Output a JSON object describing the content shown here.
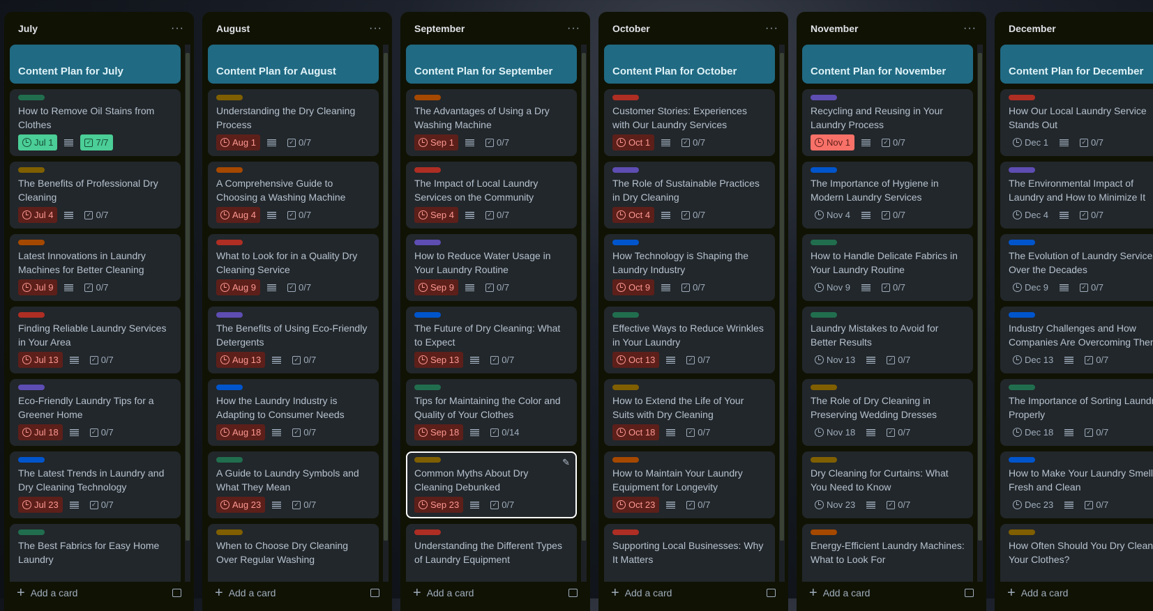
{
  "colors": {
    "green": "#216e4e",
    "yellow": "#7f5f01",
    "orange": "#a54800",
    "red": "#ae2e24",
    "purple": "#5e4db2",
    "blue": "#0055cc",
    "header_card": "#206a83"
  },
  "add_card_label": "Add a card",
  "lists": [
    {
      "title": "July",
      "header_card": "Content Plan for July",
      "cards": [
        {
          "label": "green",
          "title": "How to Remove Oil Stains from Clothes",
          "due": "Jul 1",
          "due_state": "complete",
          "checklist": "7/7",
          "checklist_state": "complete"
        },
        {
          "label": "yellow",
          "title": "The Benefits of Professional Dry Cleaning",
          "due": "Jul 4",
          "due_state": "overdue",
          "checklist": "0/7"
        },
        {
          "label": "orange",
          "title": "Latest Innovations in Laundry Machines for Better Cleaning",
          "due": "Jul 9",
          "due_state": "overdue",
          "checklist": "0/7"
        },
        {
          "label": "red",
          "title": "Finding Reliable Laundry Services in Your Area",
          "due": "Jul 13",
          "due_state": "overdue",
          "checklist": "0/7"
        },
        {
          "label": "purple",
          "title": "Eco-Friendly Laundry Tips for a Greener Home",
          "due": "Jul 18",
          "due_state": "overdue",
          "checklist": "0/7"
        },
        {
          "label": "blue",
          "title": "The Latest Trends in Laundry and Dry Cleaning Technology",
          "due": "Jul 23",
          "due_state": "overdue",
          "checklist": "0/7"
        },
        {
          "label": "green",
          "title": "The Best Fabrics for Easy Home Laundry"
        }
      ]
    },
    {
      "title": "August",
      "header_card": "Content Plan for August",
      "cards": [
        {
          "label": "yellow",
          "title": "Understanding the Dry Cleaning Process",
          "due": "Aug 1",
          "due_state": "overdue",
          "checklist": "0/7"
        },
        {
          "label": "orange",
          "title": "A Comprehensive Guide to Choosing a Washing Machine",
          "due": "Aug 4",
          "due_state": "overdue",
          "checklist": "0/7"
        },
        {
          "label": "red",
          "title": "What to Look for in a Quality Dry Cleaning Service",
          "due": "Aug 9",
          "due_state": "overdue",
          "checklist": "0/7"
        },
        {
          "label": "purple",
          "title": "The Benefits of Using Eco-Friendly Detergents",
          "due": "Aug 13",
          "due_state": "overdue",
          "checklist": "0/7"
        },
        {
          "label": "blue",
          "title": "How the Laundry Industry is Adapting to Consumer Needs",
          "due": "Aug 18",
          "due_state": "overdue",
          "checklist": "0/7"
        },
        {
          "label": "green",
          "title": "A Guide to Laundry Symbols and What They Mean",
          "due": "Aug 23",
          "due_state": "overdue",
          "checklist": "0/7"
        },
        {
          "label": "yellow",
          "title": "When to Choose Dry Cleaning Over Regular Washing"
        }
      ]
    },
    {
      "title": "September",
      "header_card": "Content Plan for September",
      "cards": [
        {
          "label": "orange",
          "title": "The Advantages of Using a Dry Washing Machine",
          "due": "Sep 1",
          "due_state": "overdue",
          "checklist": "0/7"
        },
        {
          "label": "red",
          "title": "The Impact of Local Laundry Services on the Community",
          "due": "Sep 4",
          "due_state": "overdue",
          "checklist": "0/7"
        },
        {
          "label": "purple",
          "title": "How to Reduce Water Usage in Your Laundry Routine",
          "due": "Sep 9",
          "due_state": "overdue",
          "checklist": "0/7"
        },
        {
          "label": "blue",
          "title": "The Future of Dry Cleaning: What to Expect",
          "due": "Sep 13",
          "due_state": "overdue",
          "checklist": "0/7"
        },
        {
          "label": "green",
          "title": "Tips for Maintaining the Color and Quality of Your Clothes",
          "due": "Sep 18",
          "due_state": "overdue",
          "checklist": "0/14"
        },
        {
          "label": "yellow",
          "title": "Common Myths About Dry Cleaning Debunked",
          "due": "Sep 23",
          "due_state": "overdue",
          "checklist": "0/7",
          "selected": true
        },
        {
          "label": "red",
          "title": "Understanding the Different Types of Laundry Equipment"
        }
      ]
    },
    {
      "title": "October",
      "header_card": "Content Plan for October",
      "cards": [
        {
          "label": "red",
          "title": "Customer Stories: Experiences with Our Laundry Services",
          "due": "Oct 1",
          "due_state": "overdue",
          "checklist": "0/7"
        },
        {
          "label": "purple",
          "title": "The Role of Sustainable Practices in Dry Cleaning",
          "due": "Oct 4",
          "due_state": "overdue",
          "checklist": "0/7"
        },
        {
          "label": "blue",
          "title": "How Technology is Shaping the Laundry Industry",
          "due": "Oct 9",
          "due_state": "overdue",
          "checklist": "0/7"
        },
        {
          "label": "green",
          "title": "Effective Ways to Reduce Wrinkles in Your Laundry",
          "due": "Oct 13",
          "due_state": "overdue",
          "checklist": "0/7"
        },
        {
          "label": "yellow",
          "title": "How to Extend the Life of Your Suits with Dry Cleaning",
          "due": "Oct 18",
          "due_state": "overdue",
          "checklist": "0/7"
        },
        {
          "label": "orange",
          "title": "How to Maintain Your Laundry Equipment for Longevity",
          "due": "Oct 23",
          "due_state": "overdue",
          "checklist": "0/7"
        },
        {
          "label": "red",
          "title": "Supporting Local Businesses: Why It Matters"
        }
      ]
    },
    {
      "title": "November",
      "header_card": "Content Plan for November",
      "cards": [
        {
          "label": "purple",
          "title": "Recycling and Reusing in Your Laundry Process",
          "due": "Nov 1",
          "due_state": "soon",
          "checklist": "0/7"
        },
        {
          "label": "blue",
          "title": "The Importance of Hygiene in Modern Laundry Services",
          "due": "Nov 4",
          "due_state": "plain",
          "checklist": "0/7"
        },
        {
          "label": "green",
          "title": "How to Handle Delicate Fabrics in Your Laundry Routine",
          "due": "Nov 9",
          "due_state": "plain",
          "checklist": "0/7"
        },
        {
          "label": "green",
          "title": "Laundry Mistakes to Avoid for Better Results",
          "due": "Nov 13",
          "due_state": "plain",
          "checklist": "0/7"
        },
        {
          "label": "yellow",
          "title": "The Role of Dry Cleaning in Preserving Wedding Dresses",
          "due": "Nov 18",
          "due_state": "plain",
          "checklist": "0/7"
        },
        {
          "label": "yellow",
          "title": "Dry Cleaning for Curtains: What You Need to Know",
          "due": "Nov 23",
          "due_state": "plain",
          "checklist": "0/7"
        },
        {
          "label": "orange",
          "title": "Energy-Efficient Laundry Machines: What to Look For"
        }
      ]
    },
    {
      "title": "December",
      "header_card": "Content Plan for December",
      "cards": [
        {
          "label": "red",
          "title": "How Our Local Laundry Service Stands Out",
          "due": "Dec 1",
          "due_state": "plain",
          "checklist": "0/7"
        },
        {
          "label": "purple",
          "title": "The Environmental Impact of Laundry and How to Minimize It",
          "due": "Dec 4",
          "due_state": "plain",
          "checklist": "0/7"
        },
        {
          "label": "blue",
          "title": "The Evolution of Laundry Services Over the Decades",
          "due": "Dec 9",
          "due_state": "plain",
          "checklist": "0/7"
        },
        {
          "label": "blue",
          "title": "Industry Challenges and How Companies Are Overcoming Them",
          "due": "Dec 13",
          "due_state": "plain",
          "checklist": "0/7"
        },
        {
          "label": "green",
          "title": "The Importance of Sorting Laundry Properly",
          "due": "Dec 18",
          "due_state": "plain",
          "checklist": "0/7"
        },
        {
          "label": "blue",
          "title": "How to Make Your Laundry Smell Fresh and Clean",
          "due": "Dec 23",
          "due_state": "plain",
          "checklist": "0/7"
        },
        {
          "label": "yellow",
          "title": "How Often Should You Dry Clean Your Clothes?"
        }
      ]
    }
  ]
}
